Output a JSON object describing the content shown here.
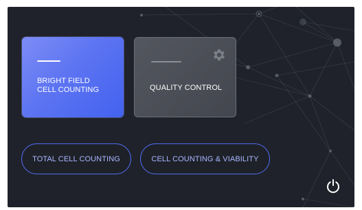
{
  "tiles": {
    "bright_field": {
      "label": "BRIGHT FIELD\nCELL COUNTING"
    },
    "quality_control": {
      "label": "QUALITY CONTROL",
      "icon": "gear-icon"
    }
  },
  "buttons": {
    "total_cell_counting": "TOTAL CELL COUNTING",
    "cell_counting_viability": "CELL COUNTING & VIABILITY"
  },
  "power": {
    "icon": "power-icon"
  },
  "colors": {
    "background": "#1f222a",
    "accent": "#4f6cf0",
    "accent_text": "#a9b8ff",
    "tile_primary": "#5d74f2",
    "tile_secondary": "#4a4d55"
  }
}
